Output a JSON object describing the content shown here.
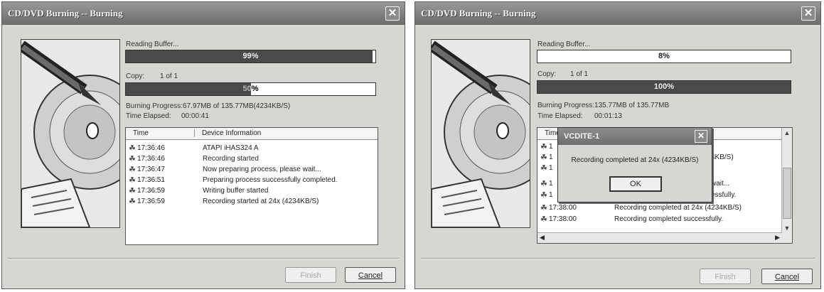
{
  "left_window": {
    "title": "CD/DVD Burning -- Burning",
    "reading_buffer_label": "Reading Buffer...",
    "reading_buffer_pct": "99%",
    "reading_buffer_fraction": 0.99,
    "copy_label": "Copy:",
    "copy_count": "1 of 1",
    "copy_pct": "50%",
    "copy_fraction": 0.5,
    "burning_progress": "Burning Progress:67.97MB of 135.77MB(4234KB/S)",
    "time_elapsed_label": "Time Elapsed:",
    "time_elapsed_value": "00:00:41",
    "log_headers": {
      "time": "Time",
      "info": "Device Information"
    },
    "log_rows": [
      {
        "time": "17:36:46",
        "msg": "ATAPI   iHAS324   A"
      },
      {
        "time": "17:36:46",
        "msg": "Recording started"
      },
      {
        "time": "17:36:47",
        "msg": "Now preparing process, please wait..."
      },
      {
        "time": "17:36:51",
        "msg": "Preparing process successfully completed."
      },
      {
        "time": "17:36:59",
        "msg": "Writing buffer started"
      },
      {
        "time": "17:36:59",
        "msg": "Recording started at 24x (4234KB/S)"
      }
    ],
    "finish_label": "Finish",
    "cancel_label": "Cancel"
  },
  "right_window": {
    "title": "CD/DVD Burning -- Burning",
    "reading_buffer_label": "Reading Buffer...",
    "reading_buffer_pct": "8%",
    "reading_buffer_fraction": 0.0,
    "copy_label": "Copy:",
    "copy_count": "1 of 1",
    "copy_pct": "100%",
    "copy_fraction": 1.0,
    "burning_progress": "Burning Progress:135.77MB of 135.77MB",
    "time_elapsed_label": "Time Elapsed:",
    "time_elapsed_value": "00:01:13",
    "log_headers": {
      "time": "Time"
    },
    "log_rows": [
      {
        "time": "1",
        "msg": ""
      },
      {
        "time": "1",
        "msg": "4KB/S)"
      },
      {
        "time": "1",
        "msg": ""
      },
      {
        "time": "1",
        "msg": "wait..."
      },
      {
        "time": "1",
        "msg": "essfully."
      },
      {
        "time": "17:38:00",
        "msg": "Recording completed at 24x (4234KB/S)"
      },
      {
        "time": "17:38:00",
        "msg": "Recording completed successfully."
      }
    ],
    "finish_label": "Finish",
    "cancel_label": "Cancel",
    "dialog": {
      "title": "VCDITE-1",
      "message": "Recording completed at 24x (4234KB/S)",
      "ok_label": "OK"
    }
  },
  "icons": [
    "close-icon",
    "disc-burn-icon",
    "log-entry-icon",
    "scroll-up-icon",
    "scroll-down-icon"
  ],
  "colors": {
    "title_bar": "#7c7c7c",
    "progress_fill": "#4a4a4a",
    "window_bg": "#d8d6d2"
  }
}
